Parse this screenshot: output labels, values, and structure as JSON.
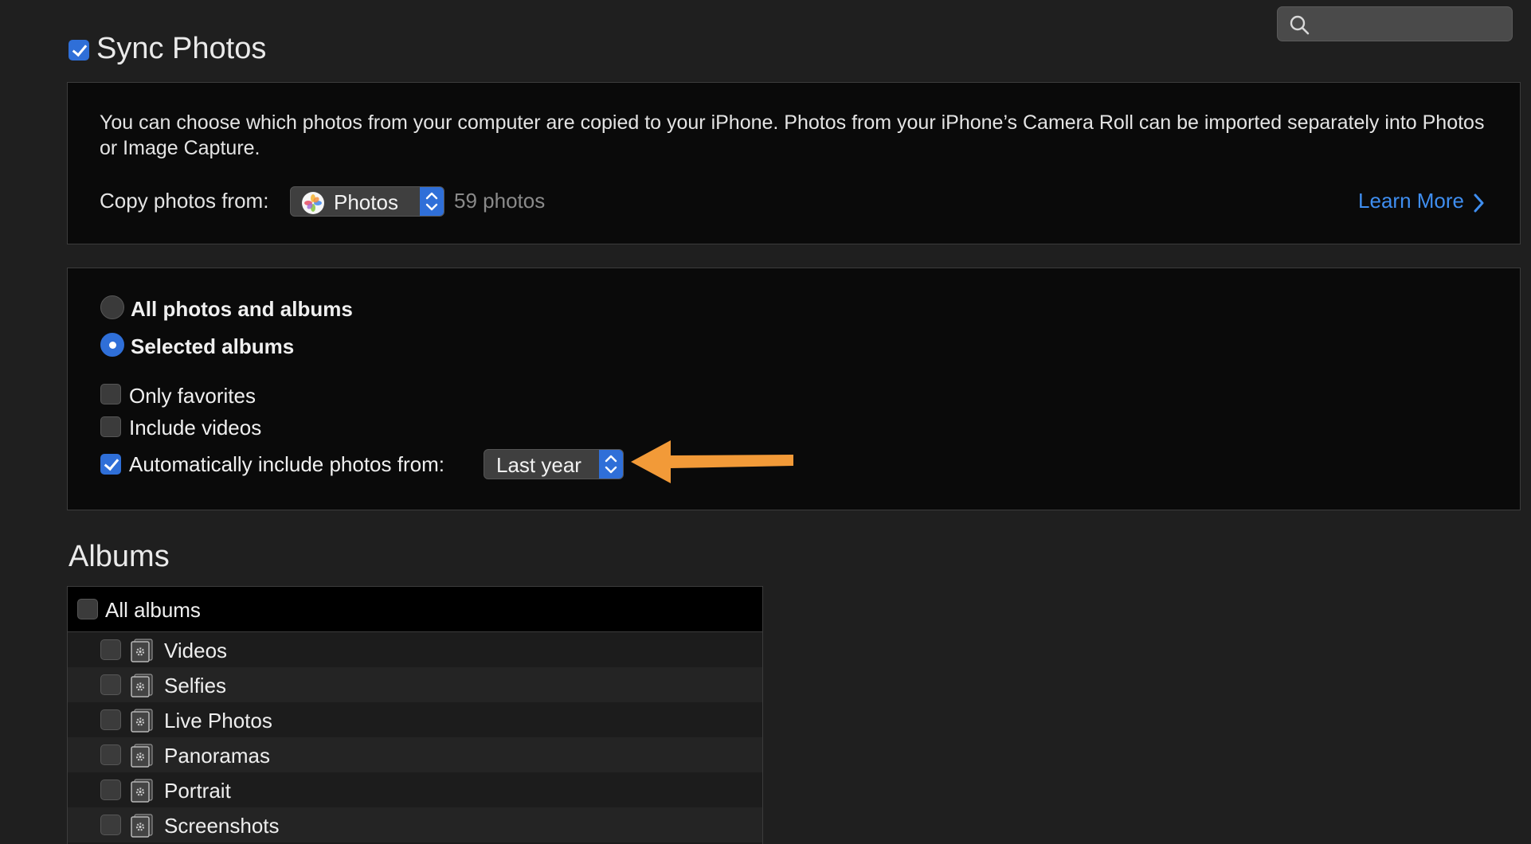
{
  "search": {
    "placeholder": "",
    "value": ""
  },
  "sync": {
    "title": "Sync Photos",
    "checked": true
  },
  "info": {
    "description": "You can choose which photos from your computer are copied to your iPhone. Photos from your iPhone’s Camera Roll can be imported separately into Photos or Image Capture.",
    "copy_label": "Copy photos from:",
    "source_value": "Photos",
    "count": "59 photos",
    "learn_more": "Learn More"
  },
  "options": {
    "radio_all": "All photos and albums",
    "radio_selected": "Selected albums",
    "selected_mode": "Selected albums",
    "only_favorites": "Only favorites",
    "include_videos": "Include videos",
    "auto_include": "Automatically include photos from:",
    "auto_value": "Last year"
  },
  "albums": {
    "title": "Albums",
    "all_label": "All albums",
    "items": [
      {
        "label": "Videos"
      },
      {
        "label": "Selfies"
      },
      {
        "label": "Live Photos"
      },
      {
        "label": "Panoramas"
      },
      {
        "label": "Portrait"
      },
      {
        "label": "Screenshots"
      }
    ]
  },
  "colors": {
    "background": "#1f1f1f",
    "panel": "#0a0a0a",
    "accent": "#2f6fd8",
    "link": "#3f8ef0",
    "annotation_arrow": "#f29a38"
  },
  "icons": {
    "search": "search-icon",
    "photos_app": "photos-app-icon",
    "chevron": "chevron-right-icon",
    "popup_arrows": "popup-arrows-icon",
    "album": "smart-album-icon",
    "annotation": "arrow-left-icon"
  }
}
